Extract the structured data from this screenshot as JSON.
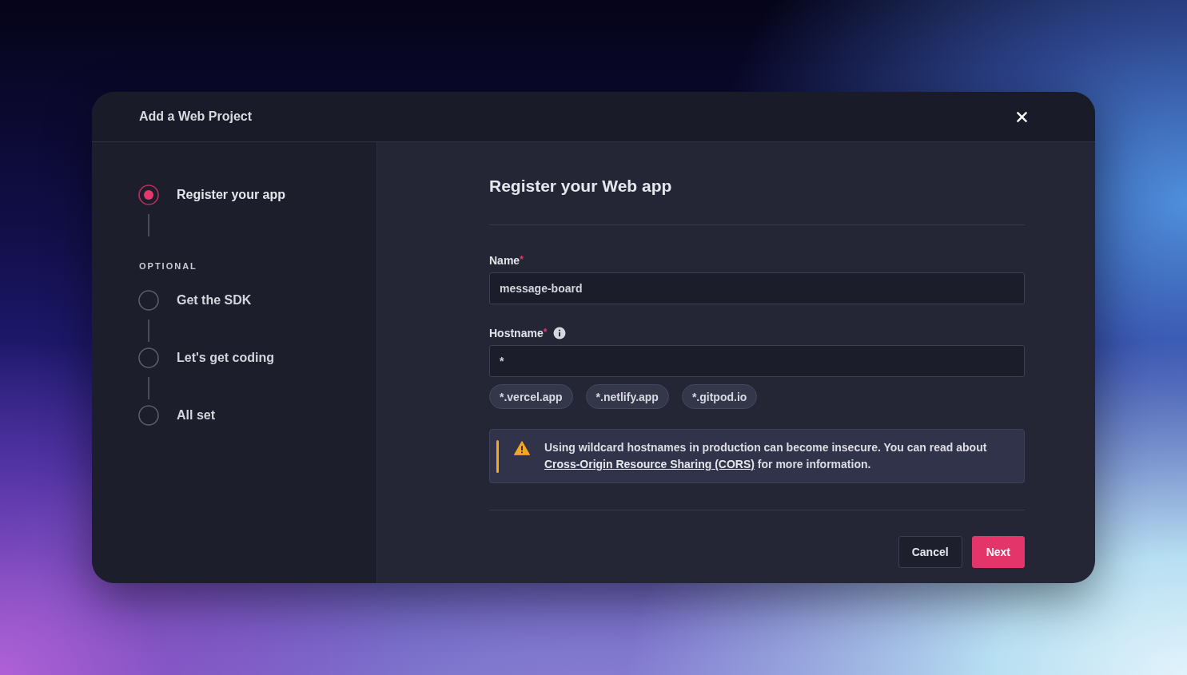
{
  "dialog": {
    "title": "Add a Web Project"
  },
  "sidebar": {
    "steps": [
      {
        "label": "Register your app",
        "selected": true
      }
    ],
    "optional": {
      "heading": "OPTIONAL",
      "steps": [
        {
          "label": "Get the SDK",
          "selected": false
        },
        {
          "label": "Let's get coding",
          "selected": false
        },
        {
          "label": "All set",
          "selected": false
        }
      ]
    }
  },
  "form": {
    "title": "Register your Web app",
    "fields": [
      {
        "label": "Name",
        "required_mark": "*",
        "info": false,
        "value": "message-board"
      },
      {
        "label": "Hostname",
        "required_mark": "*",
        "info": true,
        "value": "*"
      }
    ],
    "suggestions": [
      "*.vercel.app",
      "*.netlify.app",
      "*.gitpod.io"
    ],
    "alert": {
      "kind": "warning",
      "text_before": "Using wildcard hostnames in production can become insecure. You can read about",
      "link": "Cross-Origin Resource Sharing (CORS)",
      "text_after": "for more information."
    },
    "buttons": [
      {
        "label": "Cancel",
        "kind": "secondary"
      },
      {
        "label": "Next",
        "kind": "primary"
      }
    ]
  }
}
